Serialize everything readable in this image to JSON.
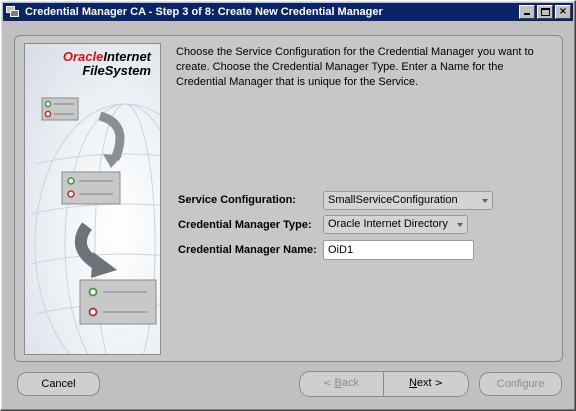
{
  "window": {
    "title": "Credential Manager CA - Step 3 of 8: Create New Credential Manager",
    "controls": {
      "minimize": "_",
      "maximize": "□",
      "close": "×"
    }
  },
  "logo": {
    "brand": "Oracle",
    "product_line1": "Internet",
    "product_line2": "FileSystem"
  },
  "instructions": "Choose the Service Configuration for the Credential Manager you want to create. Choose the Credential Manager Type. Enter a Name for the Credential Manager that is unique for the Service.",
  "form": {
    "service_configuration": {
      "label": "Service Configuration:",
      "value": "SmallServiceConfiguration"
    },
    "credential_manager_type": {
      "label": "Credential Manager Type:",
      "value": "Oracle Internet Directory"
    },
    "credential_manager_name": {
      "label": "Credential Manager Name:",
      "value": "OiD1"
    }
  },
  "buttons": {
    "cancel": "Cancel",
    "back_chevron": "<",
    "back_mnemonic": "B",
    "back_rest": "ack",
    "next_mnemonic": "N",
    "next_rest": "ext",
    "next_chevron": ">",
    "configure": "Configure"
  },
  "colors": {
    "titlebar": "#0a246a",
    "oracle_red": "#e01010",
    "window_bg": "#c0c0c0"
  }
}
